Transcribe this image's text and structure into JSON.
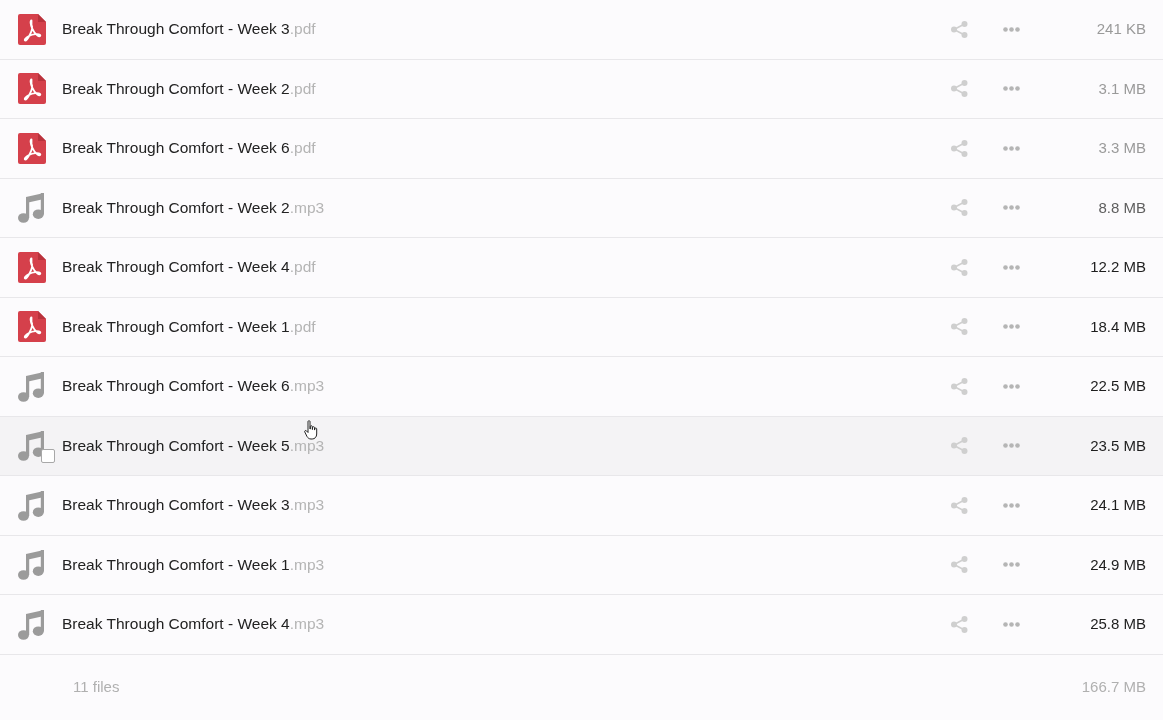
{
  "files": [
    {
      "kind": "pdf",
      "name": "Break Through Comfort - Week 3",
      "extension": ".pdf",
      "size": "241 KB",
      "size_muted": true,
      "size_dimmed": false,
      "hovered": false
    },
    {
      "kind": "pdf",
      "name": "Break Through Comfort - Week 2",
      "extension": ".pdf",
      "size": "3.1 MB",
      "size_muted": true,
      "size_dimmed": false,
      "hovered": false
    },
    {
      "kind": "pdf",
      "name": "Break Through Comfort - Week 6",
      "extension": ".pdf",
      "size": "3.3 MB",
      "size_muted": true,
      "size_dimmed": false,
      "hovered": false
    },
    {
      "kind": "audio",
      "name": "Break Through Comfort - Week 2",
      "extension": ".mp3",
      "size": "8.8 MB",
      "size_muted": false,
      "size_dimmed": true,
      "hovered": false
    },
    {
      "kind": "pdf",
      "name": "Break Through Comfort - Week 4",
      "extension": ".pdf",
      "size": "12.2 MB",
      "size_muted": false,
      "size_dimmed": false,
      "hovered": false
    },
    {
      "kind": "pdf",
      "name": "Break Through Comfort - Week 1",
      "extension": ".pdf",
      "size": "18.4 MB",
      "size_muted": false,
      "size_dimmed": false,
      "hovered": false
    },
    {
      "kind": "audio",
      "name": "Break Through Comfort - Week 6",
      "extension": ".mp3",
      "size": "22.5 MB",
      "size_muted": false,
      "size_dimmed": false,
      "hovered": false
    },
    {
      "kind": "audio",
      "name": "Break Through Comfort - Week 5",
      "extension": ".mp3",
      "size": "23.5 MB",
      "size_muted": false,
      "size_dimmed": false,
      "hovered": true
    },
    {
      "kind": "audio",
      "name": "Break Through Comfort - Week 3",
      "extension": ".mp3",
      "size": "24.1 MB",
      "size_muted": false,
      "size_dimmed": false,
      "hovered": false
    },
    {
      "kind": "audio",
      "name": "Break Through Comfort - Week 1",
      "extension": ".mp3",
      "size": "24.9 MB",
      "size_muted": false,
      "size_dimmed": false,
      "hovered": false
    },
    {
      "kind": "audio",
      "name": "Break Through Comfort - Week 4",
      "extension": ".mp3",
      "size": "25.8 MB",
      "size_muted": false,
      "size_dimmed": false,
      "hovered": false
    }
  ],
  "footer": {
    "count": "11 files",
    "total": "166.7 MB"
  }
}
